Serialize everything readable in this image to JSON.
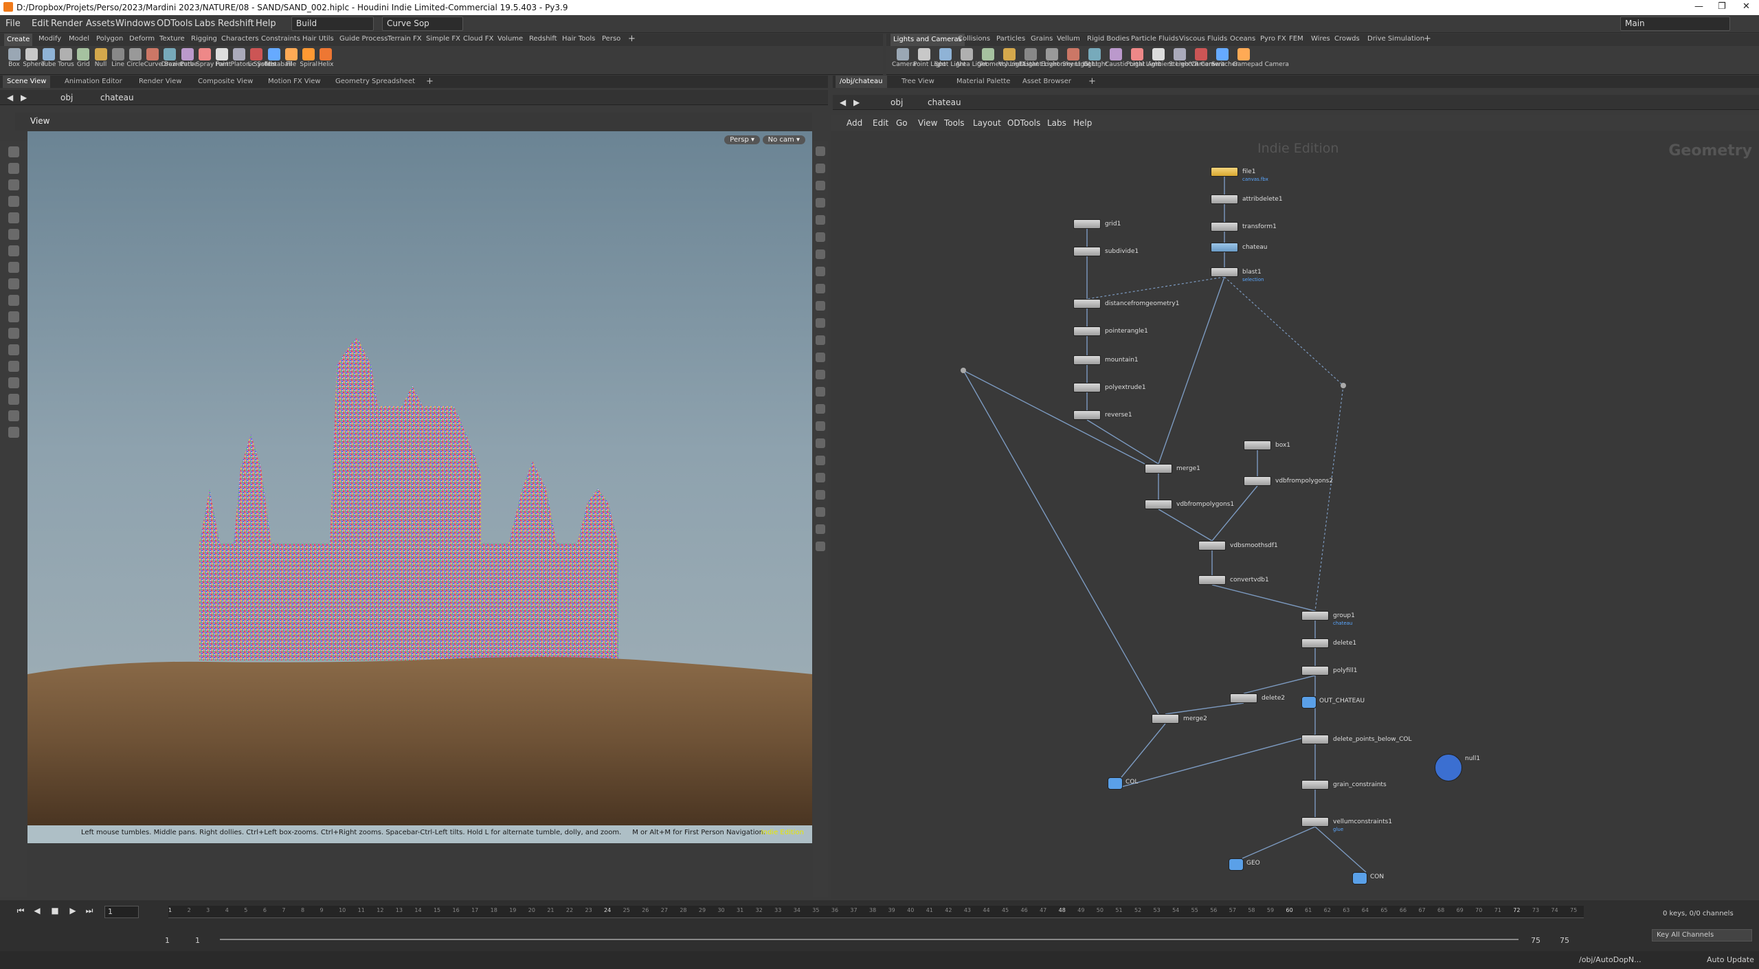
{
  "window": {
    "title": "D:/Dropbox/Projets/Perso/2023/Mardini 2023/NATURE/08 - SAND/SAND_002.hiplc - Houdini Indie Limited-Commercial 19.5.403 - Py3.9"
  },
  "menubar": {
    "items": [
      "File",
      "Edit",
      "Render",
      "Assets",
      "Windows",
      "ODTools",
      "Labs",
      "Redshift",
      "Help"
    ],
    "desktop": "Build",
    "sop": "Curve Sop",
    "main": "Main"
  },
  "shelf_left": {
    "tabs": [
      "Create",
      "Modify",
      "Model",
      "Polygon",
      "Deform",
      "Texture",
      "Rigging",
      "Characters",
      "Constraints",
      "Hair Utils",
      "Guide Process",
      "Terrain FX",
      "Simple FX",
      "Cloud FX",
      "Volume",
      "Redshift",
      "Hair Tools",
      "Perso"
    ],
    "tools": [
      "Box",
      "Sphere",
      "Tube",
      "Torus",
      "Grid",
      "Null",
      "Line",
      "Circle",
      "Curve Bezier",
      "Draw Curve",
      "Path",
      "Spray Paint",
      "Font",
      "Platonic Solids",
      "L-System",
      "Metaball",
      "File",
      "Spiral",
      "Helix"
    ]
  },
  "shelf_right": {
    "tabs": [
      "Lights and Cameras",
      "Collisions",
      "Particles",
      "Grains",
      "Vellum",
      "Rigid Bodies",
      "Particle Fluids",
      "Viscous Fluids",
      "Oceans",
      "Pyro FX",
      "FEM",
      "Wires",
      "Crowds",
      "Drive Simulation"
    ],
    "tools": [
      "Camera",
      "Point Light",
      "Spot Light",
      "Area Light",
      "Geometry Light",
      "Volume Light",
      "Distant Light",
      "Environment Light",
      "Sky Light",
      "GI Light",
      "Caustic Light",
      "Portal Light",
      "Ambient Light",
      "Stereo Camera",
      "VR Camera",
      "Switcher",
      "Gamepad Camera"
    ]
  },
  "left_panel": {
    "tabs": [
      "Scene View",
      "Animation Editor",
      "Render View",
      "Composite View",
      "Motion FX View",
      "Geometry Spreadsheet"
    ],
    "path": [
      "obj",
      "chateau"
    ],
    "view_label": "View",
    "persp": "Persp",
    "cam": "No cam",
    "hint": "Left mouse tumbles. Middle pans. Right dollies. Ctrl+Left box-zooms. Ctrl+Right zooms. Spacebar-Ctrl-Left tilts. Hold L for alternate tumble, dolly, and zoom.     M or Alt+M for First Person Navigation.",
    "edition": "Indie Edition"
  },
  "right_panel": {
    "tabs": [
      "/obj/chateau",
      "Tree View",
      "Material Palette",
      "Asset Browser"
    ],
    "path": [
      "obj",
      "chateau"
    ],
    "menu": [
      "Add",
      "Edit",
      "Go",
      "View",
      "Tools",
      "Layout",
      "ODTools",
      "Labs",
      "Help"
    ],
    "watermark": "Indie Edition",
    "context": "Geometry"
  },
  "nodes": [
    {
      "name": "file1",
      "sub": "canvas.fbx"
    },
    {
      "name": "attribdelete1",
      "sub": ""
    },
    {
      "name": "transform1",
      "sub": ""
    },
    {
      "name": "chateau",
      "sub": ""
    },
    {
      "name": "blast1",
      "sub": "selection"
    },
    {
      "name": "grid1",
      "sub": ""
    },
    {
      "name": "subdivide1",
      "sub": ""
    },
    {
      "name": "distancefromgeometry1",
      "sub": ""
    },
    {
      "name": "pointerangle1",
      "sub": ""
    },
    {
      "name": "mountain1",
      "sub": ""
    },
    {
      "name": "polyextrude1",
      "sub": ""
    },
    {
      "name": "reverse1",
      "sub": ""
    },
    {
      "name": "merge1",
      "sub": ""
    },
    {
      "name": "box1",
      "sub": ""
    },
    {
      "name": "vdbfrompolygons2",
      "sub": ""
    },
    {
      "name": "vdbfrompolygons1",
      "sub": ""
    },
    {
      "name": "vdbsmoothsdf1",
      "sub": ""
    },
    {
      "name": "convertvdb1",
      "sub": ""
    },
    {
      "name": "group1",
      "sub": "chateau"
    },
    {
      "name": "delete1",
      "sub": ""
    },
    {
      "name": "polyfill1",
      "sub": ""
    },
    {
      "name": "delete2",
      "sub": ""
    },
    {
      "name": "OUT_CHATEAU",
      "sub": ""
    },
    {
      "name": "merge2",
      "sub": ""
    },
    {
      "name": "delete_points_below_COL",
      "sub": ""
    },
    {
      "name": "COL",
      "sub": ""
    },
    {
      "name": "grain_constraints",
      "sub": ""
    },
    {
      "name": "vellumconstraints1",
      "sub": "glue"
    },
    {
      "name": "GEO",
      "sub": ""
    },
    {
      "name": "CON",
      "sub": ""
    },
    {
      "name": "null1",
      "sub": ""
    }
  ],
  "timeline": {
    "frame": "1",
    "start": "1",
    "start2": "1",
    "end": "75",
    "end2": "75",
    "ticks": [
      "1",
      "24",
      "48",
      "60",
      "72"
    ],
    "keys": "0 keys, 0/0 channels",
    "key_all": "Key All Channels",
    "auto_update": "Auto Update",
    "node_path": "/obj/AutoDopN..."
  }
}
